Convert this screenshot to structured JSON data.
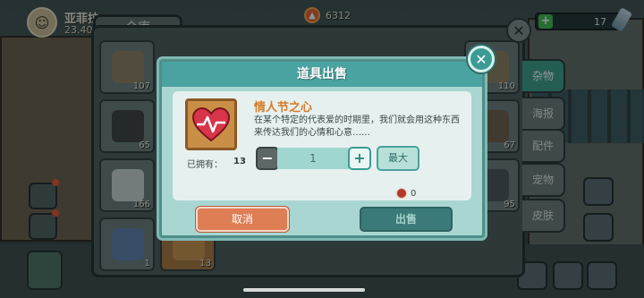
{
  "player": {
    "name": "亚菲拉",
    "coords": "23.40"
  },
  "resources": {
    "fire_value": "6312",
    "health_value": "17"
  },
  "inventory": {
    "tab_label": "仓库",
    "slots": [
      {
        "icon": "telescope-icon",
        "count": "107"
      },
      {
        "icon": "speaker-icon",
        "count": "65"
      },
      {
        "icon": "microscope-icon",
        "count": "166"
      },
      {
        "icon": "cloth-icon",
        "count": "1"
      },
      {
        "icon": "heart-item-icon",
        "count": "13"
      },
      {
        "icon": "box-icon",
        "count": "110"
      },
      {
        "icon": "crate-icon",
        "count": "67"
      },
      {
        "icon": "tool-icon",
        "count": "95"
      }
    ],
    "categories": [
      "杂物",
      "海报",
      "配件",
      "宠物",
      "皮肤"
    ],
    "active_category": "杂物"
  },
  "dialog": {
    "title": "道具出售",
    "item_name": "情人节之心",
    "item_desc": "在某个特定的代表爱的时期里，我们就会用这种东西来传达我们的心情和心意……",
    "owned_label": "已拥有：",
    "owned_value": "13",
    "quantity": "1",
    "max_label": "最大",
    "price": "0",
    "cancel_label": "取消",
    "sell_label": "出售"
  },
  "colors": {
    "accent": "#4aa3a0",
    "cancel": "#de7e55",
    "item_name": "#d57c2a"
  }
}
